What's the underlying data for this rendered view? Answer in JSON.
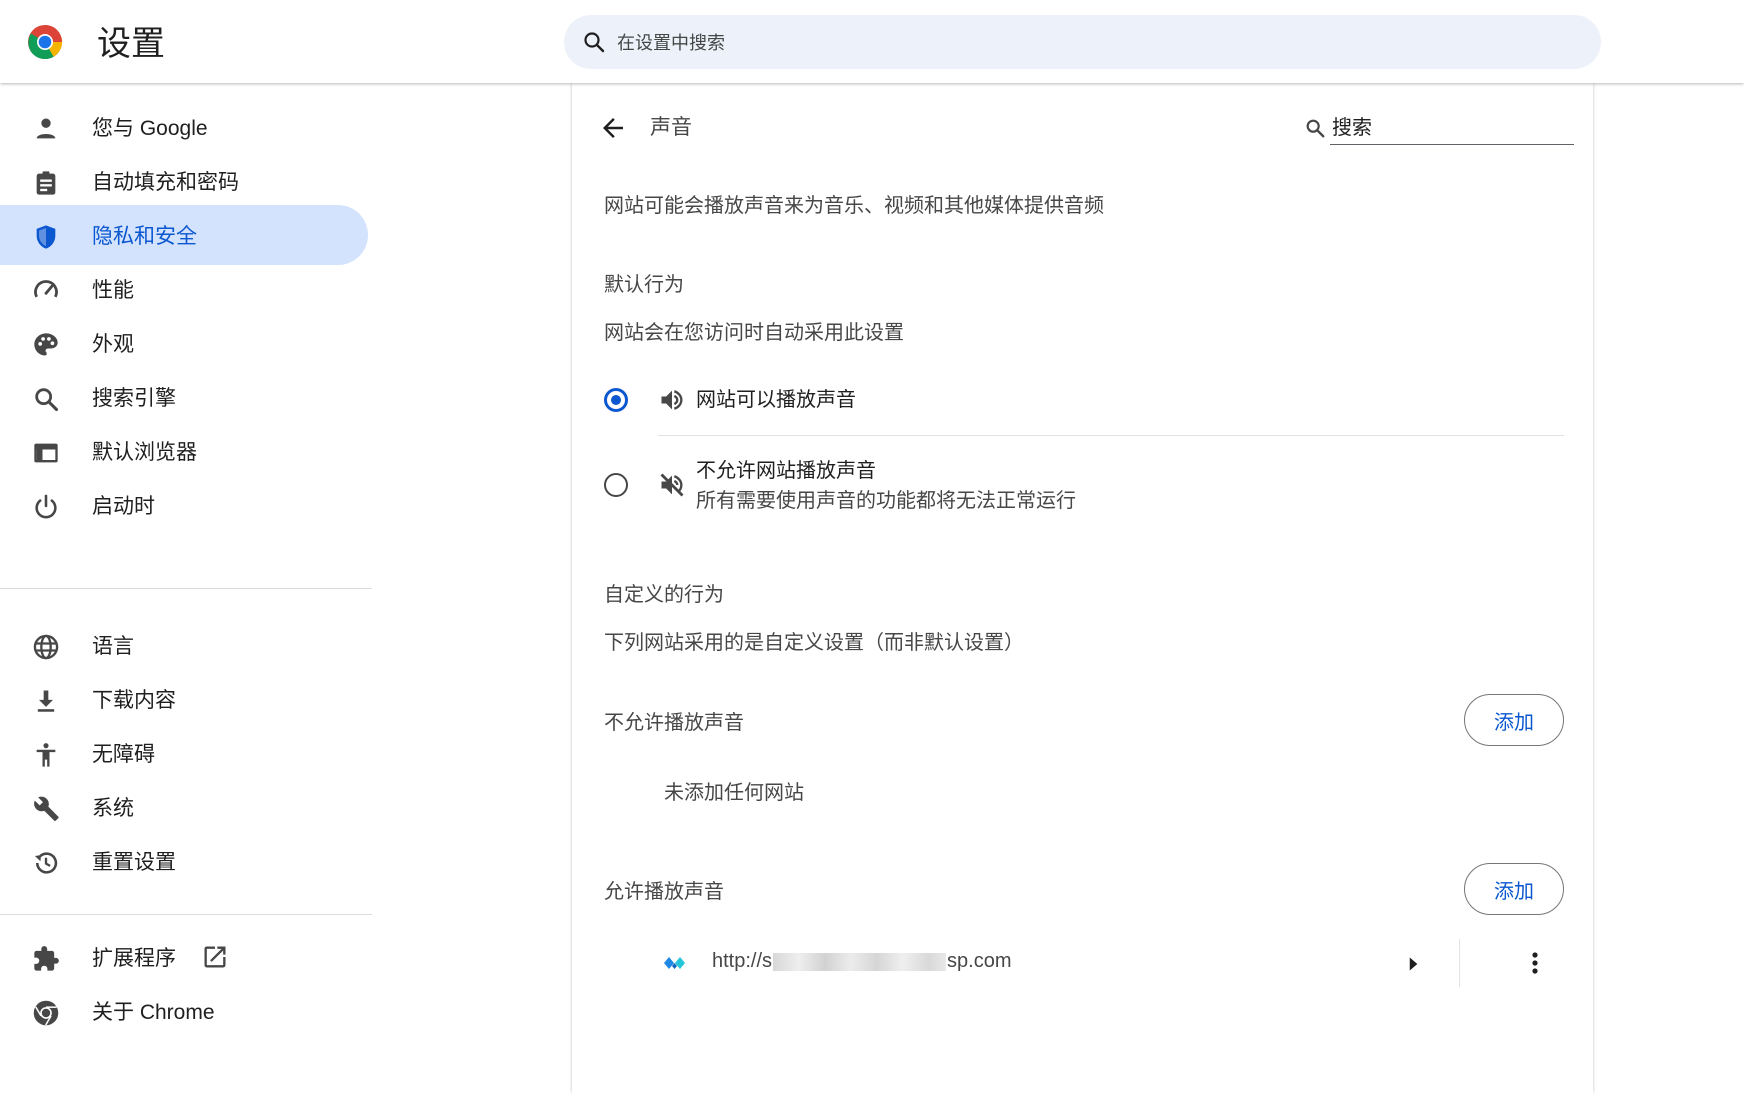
{
  "app": {
    "title": "设置",
    "search_placeholder": "在设置中搜索"
  },
  "sidebar": {
    "items": [
      {
        "label": "您与 Google",
        "icon": "person-icon"
      },
      {
        "label": "自动填充和密码",
        "icon": "clipboard-icon"
      },
      {
        "label": "隐私和安全",
        "icon": "shield-icon",
        "active": true
      },
      {
        "label": "性能",
        "icon": "speedometer-icon"
      },
      {
        "label": "外观",
        "icon": "palette-icon"
      },
      {
        "label": "搜索引擎",
        "icon": "search-icon"
      },
      {
        "label": "默认浏览器",
        "icon": "browser-icon"
      },
      {
        "label": "启动时",
        "icon": "power-icon"
      },
      {
        "label": "语言",
        "icon": "globe-icon"
      },
      {
        "label": "下载内容",
        "icon": "download-icon"
      },
      {
        "label": "无障碍",
        "icon": "accessibility-icon"
      },
      {
        "label": "系统",
        "icon": "wrench-icon"
      },
      {
        "label": "重置设置",
        "icon": "history-icon"
      },
      {
        "label": "扩展程序",
        "icon": "puzzle-icon"
      },
      {
        "label": "关于 Chrome",
        "icon": "chrome-icon"
      }
    ]
  },
  "page": {
    "title": "声音",
    "search_placeholder": "搜索",
    "description": "网站可能会播放声音来为音乐、视频和其他媒体提供音频",
    "default_heading": "默认行为",
    "default_sub": "网站会在您访问时自动采用此设置",
    "option_allow": "网站可以播放声音",
    "option_block": "不允许网站播放声音",
    "option_block_sub": "所有需要使用声音的功能都将无法正常运行",
    "custom_heading": "自定义的行为",
    "custom_sub": "下列网站采用的是自定义设置（而非默认设置）",
    "block_list_title": "不允许播放声音",
    "block_list_empty": "未添加任何网站",
    "allow_list_title": "允许播放声音",
    "add_label": "添加",
    "site_url_prefix": "http://s",
    "site_url_suffix": "sp.com"
  },
  "colors": {
    "accent": "#0b57d0",
    "active_bg": "#d3e3fd",
    "search_bg": "#edf2fa"
  }
}
